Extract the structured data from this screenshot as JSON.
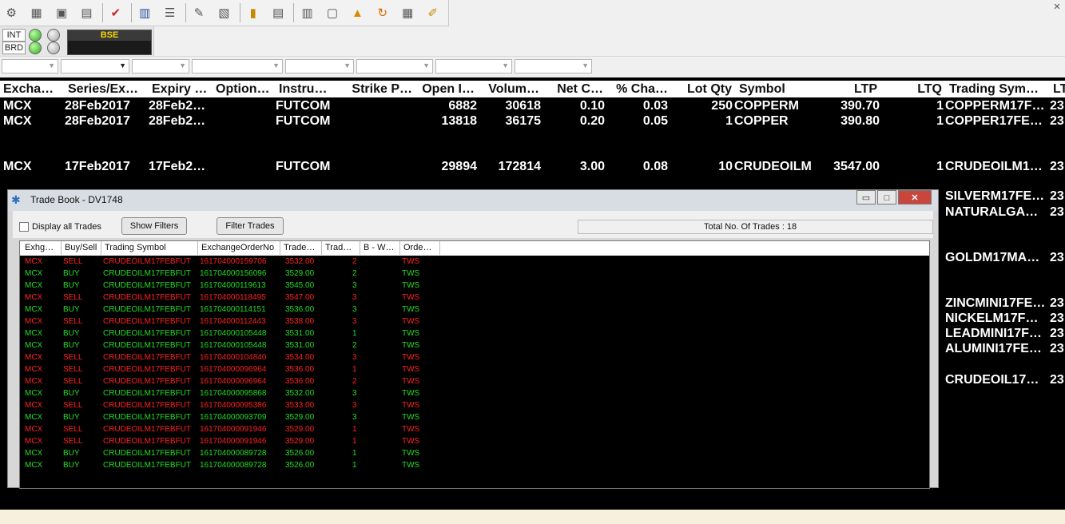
{
  "toolbar": {
    "icons": [
      "connect-icon",
      "export-icon",
      "screen-icon",
      "monitor-icon",
      "checkmark-icon",
      "book-icon",
      "list-icon",
      "tools-icon",
      "report-icon",
      "notepad-icon",
      "document-icon",
      "grid-icon",
      "settings-icon",
      "chart-icon",
      "refresh-icon",
      "clipboard-icon",
      "pencil-icon"
    ]
  },
  "status": {
    "int_label": "INT",
    "brd_label": "BRD",
    "exchange_label": "BSE"
  },
  "market_watch": {
    "columns": [
      "Excha…",
      "Series/Ex…",
      "Expiry …",
      "Option…",
      "Instru…",
      "Strike P…",
      "Open I…",
      "Volum…",
      "Net C…",
      "% Cha…",
      "Lot Qty",
      "Symbol",
      "LTP",
      "LTQ",
      "Trading Sym…",
      "LT"
    ],
    "rows": [
      {
        "exchange": "MCX",
        "series": "28Feb2017",
        "expiry": "28Feb2…",
        "instrument": "FUTCOM",
        "open_interest": "6882",
        "volume": "30618",
        "net_change": "0.10",
        "pct_change": "0.03",
        "lot_qty": "250",
        "symbol": "COPPERM",
        "ltp": "390.70",
        "ltq": "1",
        "trading_symbol": "COPPERM17F…",
        "lt": "23"
      },
      {
        "exchange": "MCX",
        "series": "28Feb2017",
        "expiry": "28Feb2…",
        "instrument": "FUTCOM",
        "open_interest": "13818",
        "volume": "36175",
        "net_change": "0.20",
        "pct_change": "0.05",
        "lot_qty": "1",
        "symbol": "COPPER",
        "ltp": "390.80",
        "ltq": "1",
        "trading_symbol": "COPPER17FE…",
        "lt": "23"
      },
      {
        "exchange": "MCX",
        "series": "17Feb2017",
        "expiry": "17Feb2…",
        "instrument": "FUTCOM",
        "open_interest": "29894",
        "volume": "172814",
        "net_change": "3.00",
        "pct_change": "0.08",
        "lot_qty": "10",
        "symbol": "CRUDEOILM",
        "ltp": "3547.00",
        "ltq": "1",
        "trading_symbol": "CRUDEOILM1…",
        "lt": "23"
      }
    ],
    "right_column_rows": [
      {
        "trading_symbol": "SILVERM17FE…",
        "lt": "23"
      },
      {
        "trading_symbol": "NATURALGA…",
        "lt": "23"
      },
      {
        "trading_symbol": "GOLDM17MA…",
        "lt": "23"
      },
      {
        "trading_symbol": "ZINCMINI17FE…",
        "lt": "23"
      },
      {
        "trading_symbol": "NICKELM17F…",
        "lt": "23"
      },
      {
        "trading_symbol": "LEADMINI17F…",
        "lt": "23"
      },
      {
        "trading_symbol": "ALUMINI17FE…",
        "lt": "23"
      },
      {
        "trading_symbol": "CRUDEOIL17…",
        "lt": "23"
      }
    ]
  },
  "trade_book": {
    "title": "Trade Book - DV1748",
    "display_all_label": "Display all Trades",
    "show_filters_label": "Show Filters",
    "filter_trades_label": "Filter Trades",
    "total_label": "Total No. Of Trades : 18",
    "min_label": "▭",
    "max_label": "□",
    "close_label": "✕",
    "columns": [
      "Exhg…",
      "Buy/Sell",
      "Trading Symbol",
      "ExchangeOrderNo",
      "Trade…",
      "Trad…",
      "B - W…",
      "Orde…"
    ],
    "rows": [
      {
        "exchange": "MCX",
        "side": "SELL",
        "symbol": "CRUDEOILM17FEBFUT",
        "order_no": "161704000159706",
        "price": "3532.00",
        "qty": "2",
        "order": "TWS"
      },
      {
        "exchange": "MCX",
        "side": "BUY",
        "symbol": "CRUDEOILM17FEBFUT",
        "order_no": "161704000156096",
        "price": "3529.00",
        "qty": "2",
        "order": "TWS"
      },
      {
        "exchange": "MCX",
        "side": "BUY",
        "symbol": "CRUDEOILM17FEBFUT",
        "order_no": "161704000119613",
        "price": "3545.00",
        "qty": "3",
        "order": "TWS"
      },
      {
        "exchange": "MCX",
        "side": "SELL",
        "symbol": "CRUDEOILM17FEBFUT",
        "order_no": "161704000118495",
        "price": "3547.00",
        "qty": "3",
        "order": "TWS"
      },
      {
        "exchange": "MCX",
        "side": "BUY",
        "symbol": "CRUDEOILM17FEBFUT",
        "order_no": "161704000114151",
        "price": "3536.00",
        "qty": "3",
        "order": "TWS"
      },
      {
        "exchange": "MCX",
        "side": "SELL",
        "symbol": "CRUDEOILM17FEBFUT",
        "order_no": "161704000112443",
        "price": "3538.00",
        "qty": "3",
        "order": "TWS"
      },
      {
        "exchange": "MCX",
        "side": "BUY",
        "symbol": "CRUDEOILM17FEBFUT",
        "order_no": "161704000105448",
        "price": "3531.00",
        "qty": "1",
        "order": "TWS"
      },
      {
        "exchange": "MCX",
        "side": "BUY",
        "symbol": "CRUDEOILM17FEBFUT",
        "order_no": "161704000105448",
        "price": "3531.00",
        "qty": "2",
        "order": "TWS"
      },
      {
        "exchange": "MCX",
        "side": "SELL",
        "symbol": "CRUDEOILM17FEBFUT",
        "order_no": "161704000104840",
        "price": "3534.00",
        "qty": "3",
        "order": "TWS"
      },
      {
        "exchange": "MCX",
        "side": "SELL",
        "symbol": "CRUDEOILM17FEBFUT",
        "order_no": "161704000096964",
        "price": "3536.00",
        "qty": "1",
        "order": "TWS"
      },
      {
        "exchange": "MCX",
        "side": "SELL",
        "symbol": "CRUDEOILM17FEBFUT",
        "order_no": "161704000096964",
        "price": "3536.00",
        "qty": "2",
        "order": "TWS"
      },
      {
        "exchange": "MCX",
        "side": "BUY",
        "symbol": "CRUDEOILM17FEBFUT",
        "order_no": "161704000095868",
        "price": "3532.00",
        "qty": "3",
        "order": "TWS"
      },
      {
        "exchange": "MCX",
        "side": "SELL",
        "symbol": "CRUDEOILM17FEBFUT",
        "order_no": "161704000095386",
        "price": "3533.00",
        "qty": "3",
        "order": "TWS"
      },
      {
        "exchange": "MCX",
        "side": "BUY",
        "symbol": "CRUDEOILM17FEBFUT",
        "order_no": "161704000093709",
        "price": "3529.00",
        "qty": "3",
        "order": "TWS"
      },
      {
        "exchange": "MCX",
        "side": "SELL",
        "symbol": "CRUDEOILM17FEBFUT",
        "order_no": "161704000091946",
        "price": "3529.00",
        "qty": "1",
        "order": "TWS"
      },
      {
        "exchange": "MCX",
        "side": "SELL",
        "symbol": "CRUDEOILM17FEBFUT",
        "order_no": "161704000091946",
        "price": "3529.00",
        "qty": "1",
        "order": "TWS"
      },
      {
        "exchange": "MCX",
        "side": "BUY",
        "symbol": "CRUDEOILM17FEBFUT",
        "order_no": "161704000089728",
        "price": "3526.00",
        "qty": "1",
        "order": "TWS"
      },
      {
        "exchange": "MCX",
        "side": "BUY",
        "symbol": "CRUDEOILM17FEBFUT",
        "order_no": "161704000089728",
        "price": "3526.00",
        "qty": "1",
        "order": "TWS"
      }
    ]
  },
  "colors": {
    "sell": "#ff2020",
    "buy": "#22dd22",
    "exchange_text": "#f5d700"
  }
}
